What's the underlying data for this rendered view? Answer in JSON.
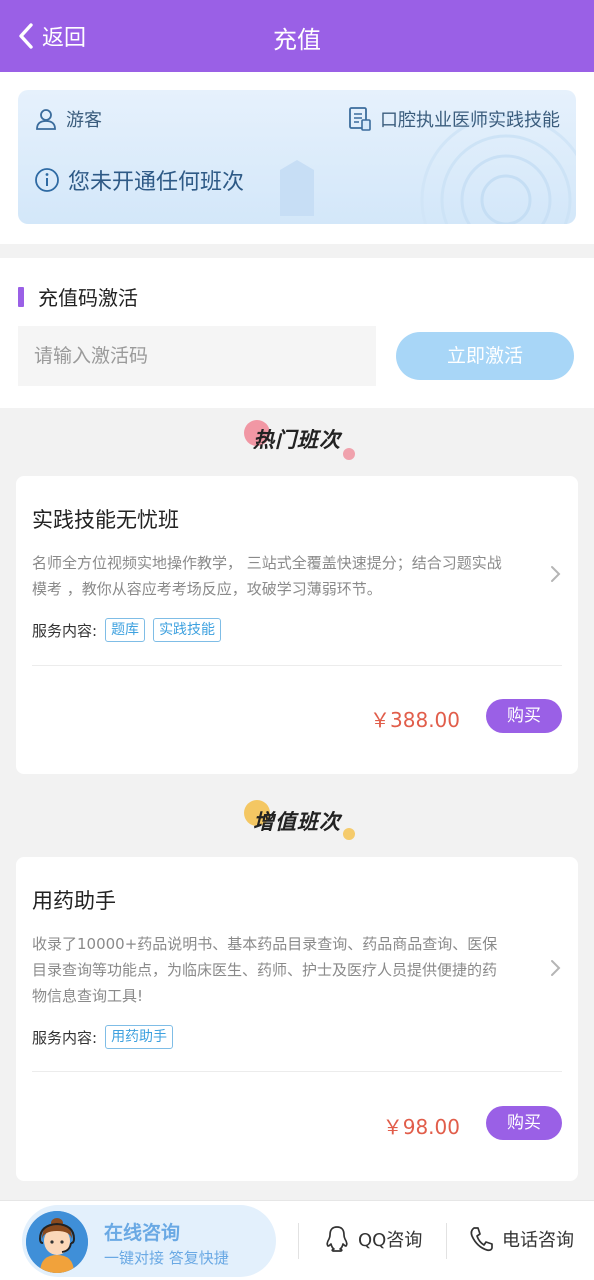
{
  "header": {
    "back_label": "返回",
    "title": "充值"
  },
  "user_card": {
    "user_name": "游客",
    "subject": "口腔执业医师实践技能",
    "status": "您未开通任何班次"
  },
  "activation": {
    "section_title": "充值码激活",
    "input_placeholder": "请输入激活码",
    "input_value": "",
    "button_label": "立即激活"
  },
  "hot_section": {
    "banner": "热门班次",
    "banner_dot_color": "#f07a8a",
    "course": {
      "name": "实践技能无忧班",
      "desc_line1": "名师全方位视频实地操作教学， 三站式全覆盖快速提分；结合习题实战",
      "desc_line2": "模考 ，教你从容应考考场反应，攻破学习薄弱环节。",
      "services_label": "服务内容:",
      "tags": [
        "题库",
        "实践技能"
      ],
      "price": "￥388.00",
      "buy_label": "购买"
    }
  },
  "value_section": {
    "banner": "增值班次",
    "banner_dot_color": "#f5c04a",
    "course": {
      "name": "用药助手",
      "desc_line1": "收录了10000+药品说明书、基本药品目录查询、药品商品查询、医保",
      "desc_line2": "目录查询等功能点，为临床医生、药师、护士及医疗人员提供便捷的药",
      "desc_line3": "物信息查询工具!",
      "services_label": "服务内容:",
      "tags": [
        "用药助手"
      ],
      "price": "￥98.00",
      "buy_label": "购买"
    }
  },
  "bottom_bar": {
    "consult_title": "在线咨询",
    "consult_subtitle": "一键对接 答复快捷",
    "qq_label": "QQ咨询",
    "phone_label": "电话咨询"
  },
  "colors": {
    "accent": "#9a60e6",
    "price": "#e15d4a",
    "tag": "#3ea1df",
    "activate_button": "#a8d6f7"
  },
  "icons": [
    "chevron-left-icon",
    "user-icon",
    "book-icon",
    "info-icon",
    "chevron-right-icon",
    "qq-icon",
    "phone-icon"
  ]
}
